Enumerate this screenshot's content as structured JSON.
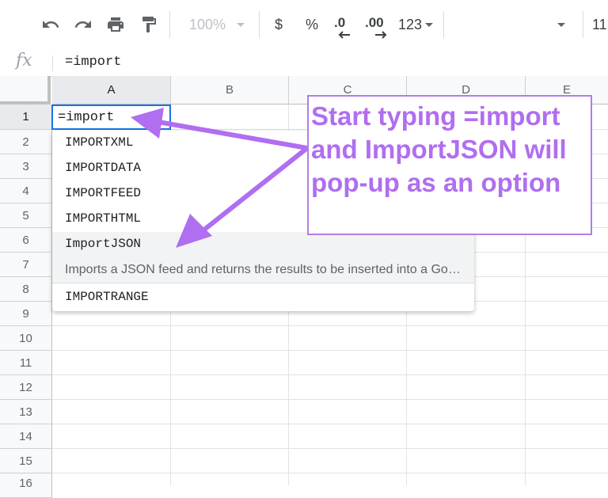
{
  "toolbar": {
    "undo_icon": "undo-icon",
    "redo_icon": "redo-icon",
    "print_icon": "print-icon",
    "paint_format_icon": "paint-format-icon",
    "zoom": "100%",
    "currency": "$",
    "percent": "%",
    "decrease_decimals": ".0",
    "increase_decimals": ".00",
    "more_formats": "123",
    "font_size": "11"
  },
  "formula_bar": {
    "fx_label": "fx",
    "content": "=import"
  },
  "sheet": {
    "columns": [
      "A",
      "B",
      "C",
      "D",
      "E"
    ],
    "rows": [
      "1",
      "2",
      "3",
      "4",
      "5",
      "6",
      "7",
      "8",
      "9",
      "10",
      "11",
      "12",
      "13",
      "14",
      "15",
      "16"
    ],
    "active_cell_value": "=import"
  },
  "autocomplete": {
    "items": [
      "IMPORTXML",
      "IMPORTDATA",
      "IMPORTFEED",
      "IMPORTHTML",
      "ImportJSON",
      "IMPORTRANGE"
    ],
    "highlighted_description": "Imports a JSON feed and returns the results to be inserted into a Google Spreadsheet."
  },
  "annotation": {
    "text": "Start typing =import and ImportJSON will pop-up as an option",
    "color": "#b06ef0"
  }
}
